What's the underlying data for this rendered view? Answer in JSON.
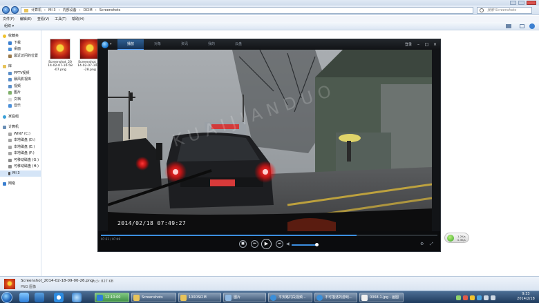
{
  "explorer": {
    "breadcrumb": [
      "计算机",
      "MI 3",
      "内部设备",
      "DCIM",
      "Screenshots"
    ],
    "search_placeholder": "搜索 Screenshots",
    "menu": [
      "文件(F)",
      "编辑(E)",
      "查看(V)",
      "工具(T)",
      "帮助(H)"
    ],
    "organize_label": "组织 ▾",
    "sidebar": {
      "favorites": {
        "header": "收藏夹",
        "items": [
          "下载",
          "桌面",
          "最近访问的位置"
        ]
      },
      "libraries": {
        "header": "库",
        "items": [
          "PPTV视频",
          "暴风影视库",
          "视频",
          "图片",
          "文档",
          "音乐"
        ]
      },
      "homegroup": "家庭组",
      "computer": {
        "header": "计算机",
        "items": [
          "WIN7 (C:)",
          "本地磁盘 (D:)",
          "本地磁盘 (E:)",
          "本地磁盘 (F:)",
          "可移动磁盘 (G:)",
          "可移动磁盘 (H:)",
          "MI 3"
        ]
      },
      "network": "网络"
    },
    "files": [
      {
        "name": "Screenshot_2014-02-07-10-58-07.png"
      },
      {
        "name": "Screenshot_2014-02-07-10-58-28.png"
      }
    ],
    "details": {
      "filename": "Screenshot_2014-02-18-09-00-26.png",
      "type": "PNG 图像",
      "size": "大小: 827 KB"
    }
  },
  "player": {
    "tabs": [
      "播放",
      "对象",
      "资讯",
      "我的",
      "云盘"
    ],
    "active_tab": "播放",
    "login": "登录",
    "time": "07:21 / 07:49",
    "osd_timestamp": "2014/02/18  07:49:27",
    "watermark": "KUAIJIANDUO",
    "progress": 0.76,
    "volume": 0.9
  },
  "widget": {
    "line1": "1.2K/s",
    "line2": "0.3K/s"
  },
  "taskbar": {
    "items": [
      {
        "label": "Screenshots",
        "color": "#e7c35a"
      },
      {
        "label": "100DSCIM",
        "color": "#e7c35a"
      },
      {
        "label": "图片",
        "color": "#8fb7e0"
      },
      {
        "label": "平安路村段视频...",
        "color": "#3b8ed8"
      },
      {
        "label": "不可描述的游戏...",
        "color": "#3b8ed8"
      },
      {
        "label": "0068-1.jpg - 画图",
        "color": "#f0f0f0"
      }
    ],
    "active_item": "12:10:00",
    "time": "9:33",
    "date": "2014/2/18"
  },
  "colors": {
    "accent": "#3c8fe0",
    "taillight": "#ff1b1b",
    "player_bg": "#121417"
  }
}
